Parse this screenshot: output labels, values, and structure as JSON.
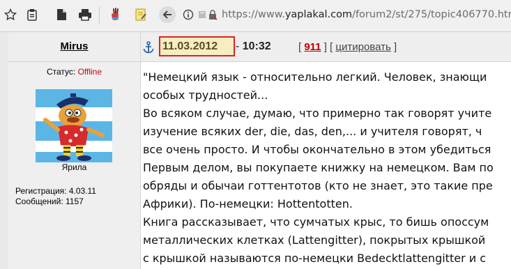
{
  "browser": {
    "url_prefix": "https://www.",
    "url_domain": "yaplakal.com",
    "url_path": "/forum2/st/275/topic406770.html",
    "icons": [
      "star-icon",
      "reading-list-icon",
      "page-icon",
      "print-icon",
      "extension-icon",
      "note-icon",
      "back-icon",
      "info-icon",
      "lock-icon"
    ]
  },
  "post": {
    "author": "Mirus",
    "date": "11.03.2012",
    "time_separator": " - ",
    "time": "10:32",
    "open_bracket": "[ ",
    "reply_count": "911",
    "mid_bracket": " ] [ ",
    "quote_label": "цитировать",
    "close_bracket": " ]",
    "status_label": "Статус: ",
    "status_value": "Offline",
    "rank": "Ярила",
    "registration": "Регистрация: 4.03.11",
    "messages": "Сообщений: 1157",
    "lines": [
      "\"Немецкий язык - относительно легкий. Человек, знающи",
      "особых трудностей...",
      "Во всяком случае, думаю, что примерно так говорят учите",
      "изучение всяких der, die, das, den,... и учителя говорят, ч",
      "все очень просто. И чтобы окончательно в этом убедиться",
      "Первым делом, вы покупаете книжку на немецком. Вам по",
      "обряды и обычаи готтентотов (кто не знает, это такие пре",
      "Африки). По-немецки: Hottentotten.",
      "Книга рассказывает, что сумчатых крыс, то бишь опоссум",
      "металлических клетках (Lattengitter), покрытых крышкой",
      "с крышкой называются по-немецки Bedecktlattengitter и с"
    ]
  },
  "colors": {
    "offline": "#cc0000",
    "reply_count": "#c00000",
    "date_box_border": "#e02020",
    "date_box_fill": "#f6eec0"
  }
}
